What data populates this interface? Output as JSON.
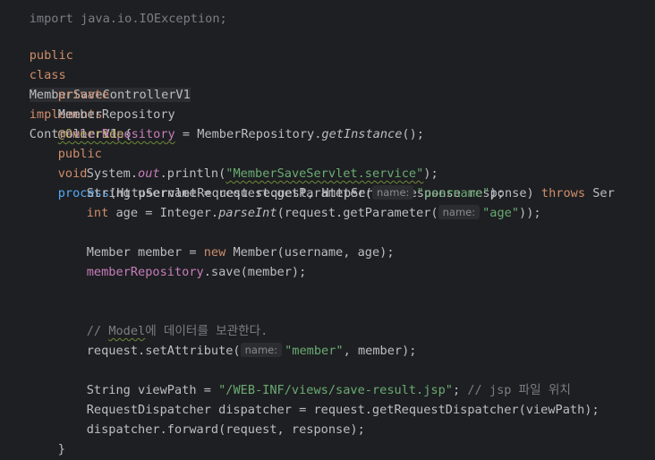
{
  "code": {
    "import_line": "import java.io.IOException;",
    "class_decl": {
      "mod_public": "public",
      "kw_class": "class",
      "class_name": "MemberSaveControllerV1",
      "kw_implements": "implements",
      "interface_name": "ControllerV1",
      "brace": " {"
    },
    "field_decl": {
      "mod_private": "private",
      "type": "MemberRepository",
      "name": "memberRepository",
      "assign": " = MemberRepository.",
      "call": "getInstance",
      "tail": "();"
    },
    "annotation": "@Override",
    "method_decl": {
      "mod_public": "public",
      "kw_void": "void",
      "name": "process",
      "params": "(HttpServletRequest request, HttpServletResponse response) ",
      "kw_throws": "throws",
      "tail": " Ser"
    },
    "println_line": {
      "system": "System.",
      "out": "out",
      "println": ".println(",
      "arg": "\"MemberSaveServlet.service\"",
      "tail": ");"
    },
    "username_line": {
      "head": "String username = request.getParameter(",
      "hint": "name:",
      "arg": "\"username\"",
      "tail": ");"
    },
    "age_line": {
      "kw_int": "int",
      "head1": " age = Integer.",
      "parse": "parseInt",
      "head2": "(request.getParameter(",
      "hint": "name:",
      "arg": "\"age\"",
      "tail": "));"
    },
    "member_line": {
      "head": "Member member = ",
      "kw_new": "new",
      "tail": " Member(username, age);"
    },
    "save_line": {
      "field": "memberRepository",
      "tail": ".save(member);"
    },
    "comment_model": {
      "prefix": "// ",
      "word": "Model",
      "rest": "에 데이터를 보관한다."
    },
    "setattr_line": {
      "head": "request.setAttribute(",
      "hint": "name:",
      "arg": "\"member\"",
      "tail": ", member);"
    },
    "viewpath_line": {
      "head": "String viewPath = ",
      "arg": "\"/WEB-INF/views/save-result.jsp\"",
      "semi": "; ",
      "comment": "// jsp 파일 위치"
    },
    "dispatcher_line": "RequestDispatcher dispatcher = request.getRequestDispatcher(viewPath);",
    "forward_line": "dispatcher.forward(request, response);",
    "method_close": "}",
    "class_close": "}"
  },
  "colors": {
    "background": "#1e1f22",
    "default_text": "#bcbec4",
    "keyword": "#cf8e6d",
    "function": "#56a8f5",
    "string": "#6aab73",
    "annotation": "#b3ae60",
    "field": "#c77dbb",
    "comment": "#7a7e85",
    "inlay_hint_bg": "#2b2d30"
  }
}
